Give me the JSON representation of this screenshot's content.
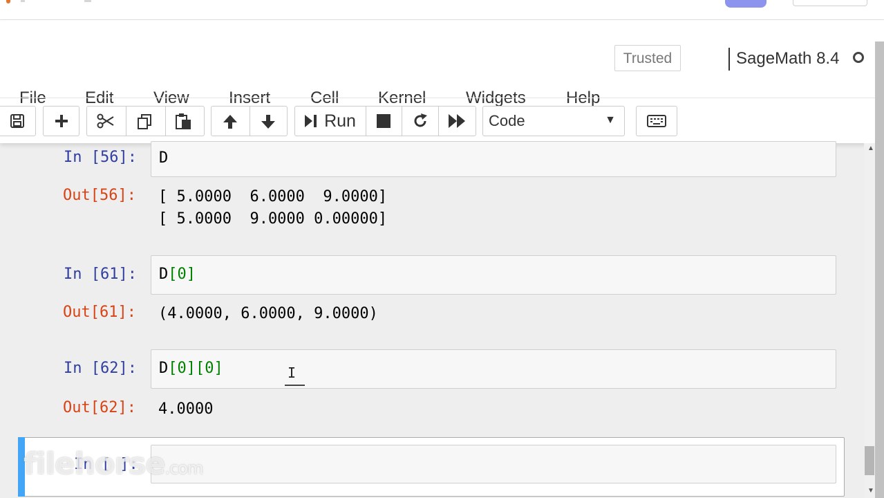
{
  "header": {
    "trusted_label": "Trusted",
    "kernel_name": "SageMath 8.4"
  },
  "menu": [
    "File",
    "Edit",
    "View",
    "Insert",
    "Cell",
    "Kernel",
    "Widgets",
    "Help"
  ],
  "toolbar": {
    "run_label": "Run",
    "cell_type": "Code",
    "icons": [
      "save-icon",
      "plus-icon",
      "scissors-icon",
      "copy-icon",
      "paste-icon",
      "arrow-up-icon",
      "arrow-down-icon",
      "run-icon",
      "stop-icon",
      "restart-icon",
      "fast-forward-icon",
      "keyboard-icon"
    ]
  },
  "cells": [
    {
      "in_prompt": "In [56]:",
      "code": "D",
      "out_prompt": "Out[56]:",
      "output": [
        "[ 5.0000  6.0000  9.0000]",
        "[ 5.0000  9.0000 0.00000]"
      ]
    },
    {
      "in_prompt": "In [61]:",
      "code_name": "D",
      "code_index": "[0]",
      "out_prompt": "Out[61]:",
      "output": "(4.0000, 6.0000, 9.0000)"
    },
    {
      "in_prompt": "In [62]:",
      "code_name": "D",
      "code_index1": "[0]",
      "code_index2": "[0]",
      "out_prompt": "Out[62]:",
      "output": "4.0000"
    },
    {
      "in_prompt": "In [ ]:",
      "code": ""
    }
  ],
  "watermark": {
    "brand": "filehorse",
    "domain": ".com"
  }
}
